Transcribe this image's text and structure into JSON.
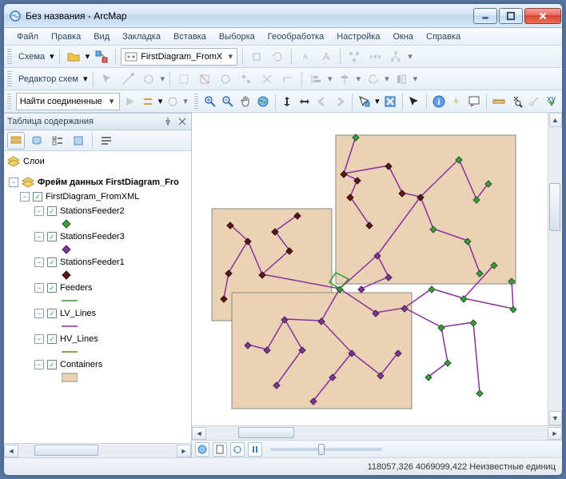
{
  "window": {
    "title": "Без названия - ArcMap"
  },
  "menubar": {
    "items": [
      "Файл",
      "Правка",
      "Вид",
      "Закладка",
      "Вставка",
      "Выборка",
      "Геообработка",
      "Настройка",
      "Окна",
      "Справка"
    ]
  },
  "toolbar1": {
    "schema_label": "Схема",
    "diagram_selector": "FirstDiagram_FromX"
  },
  "toolbar2": {
    "editor_label": "Редактор схем"
  },
  "toolbar3": {
    "find_label": "Найти соединенные об"
  },
  "toc": {
    "title": "Таблица содержания",
    "layers_root": "Слои",
    "dataframe": "Фрейм данных FirstDiagram_Fro",
    "group": "FirstDiagram_FromXML",
    "layers": [
      {
        "name": "StationsFeeder2",
        "sym": "point-green"
      },
      {
        "name": "StationsFeeder3",
        "sym": "point-purple"
      },
      {
        "name": "StationsFeeder1",
        "sym": "point-darkred"
      },
      {
        "name": "Feeders",
        "sym": "line-green"
      },
      {
        "name": "LV_Lines",
        "sym": "line-purple"
      },
      {
        "name": "HV_Lines",
        "sym": "line-olive"
      },
      {
        "name": "Containers",
        "sym": "poly-tan"
      }
    ]
  },
  "status": {
    "coords": "118057,326 4069099,422 Неизвестные единиц"
  }
}
